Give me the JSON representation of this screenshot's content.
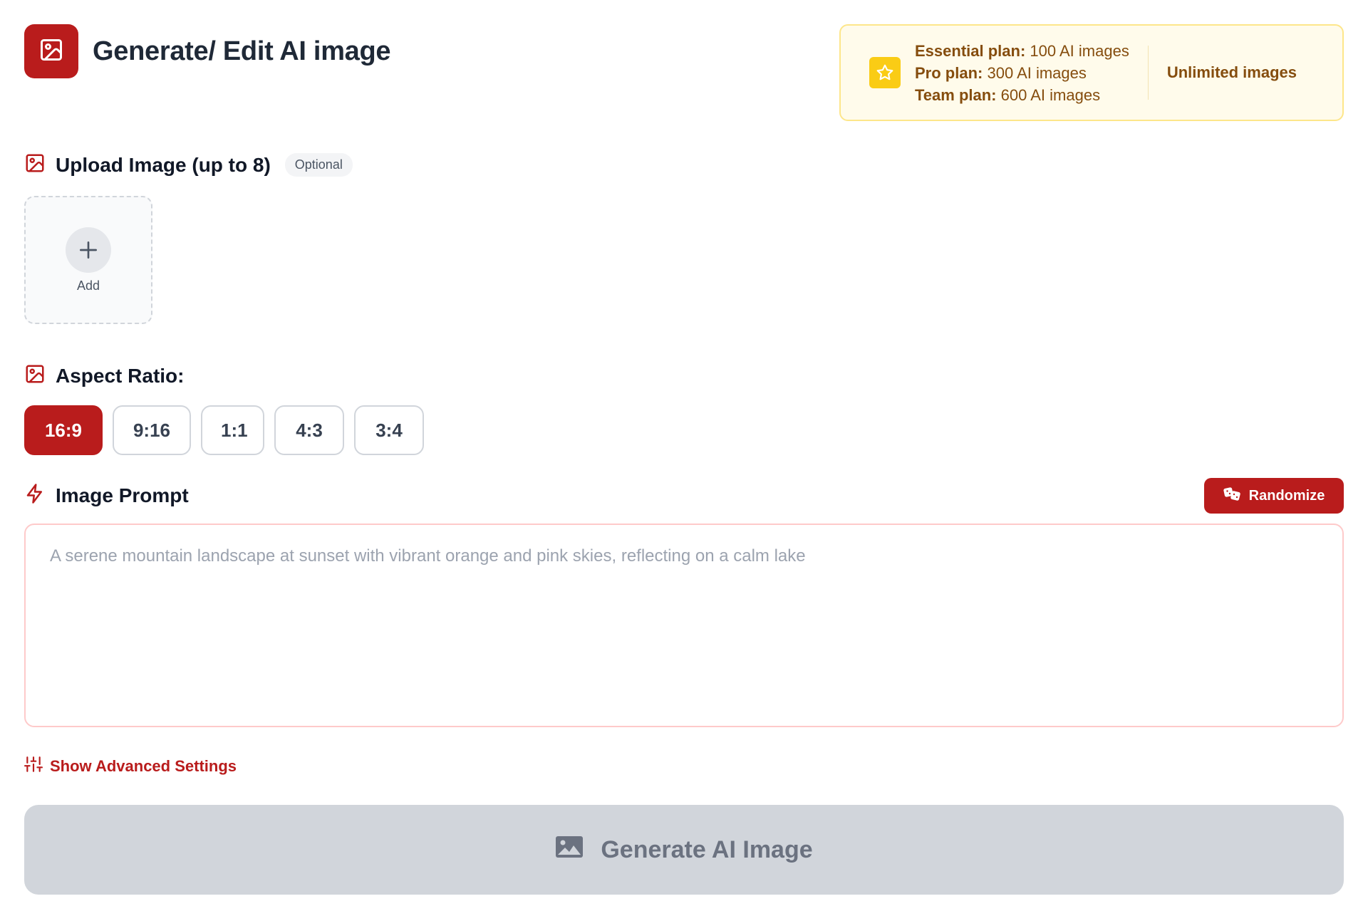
{
  "header": {
    "title": "Generate/ Edit AI image",
    "logo_icon": "image-icon",
    "accent_color": "#b91c1c"
  },
  "plans": {
    "icon": "star-icon",
    "items": [
      {
        "name": "Essential plan:",
        "value": "100 AI images"
      },
      {
        "name": "Pro plan:",
        "value": "300 AI images"
      },
      {
        "name": "Team plan:",
        "value": "600 AI images"
      }
    ],
    "unlimited_label": "Unlimited images",
    "text_color": "#854d0e",
    "background": "#fffbeb"
  },
  "upload": {
    "heading": "Upload Image (up to 8)",
    "badge": "Optional",
    "add_label": "Add",
    "icon": "image-icon"
  },
  "aspect_ratio": {
    "heading": "Aspect Ratio:",
    "icon": "image-icon",
    "options": [
      "16:9",
      "9:16",
      "1:1",
      "4:3",
      "3:4"
    ],
    "selected": "16:9"
  },
  "prompt": {
    "heading": "Image Prompt",
    "icon": "lightning-icon",
    "randomize_label": "Randomize",
    "randomize_icon": "dice-icon",
    "placeholder": "A serene mountain landscape at sunset with vibrant orange and pink skies, reflecting on a calm lake",
    "value": ""
  },
  "advanced": {
    "label": "Show Advanced Settings",
    "icon": "sliders-icon"
  },
  "generate": {
    "label": "Generate AI Image",
    "icon": "landscape-image-icon",
    "disabled": true
  }
}
